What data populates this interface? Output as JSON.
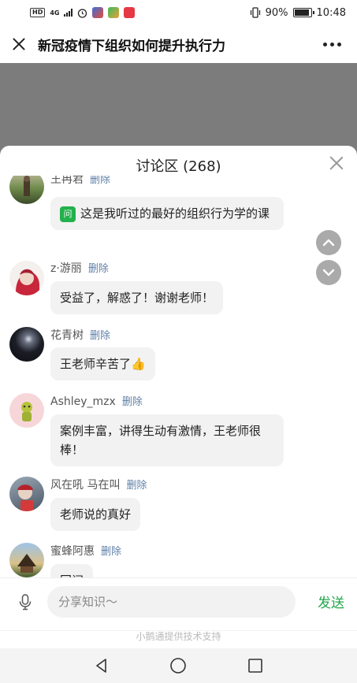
{
  "status": {
    "left": {
      "hd": "HD",
      "network": "4G"
    },
    "battery_text": "90%",
    "time": "10:48"
  },
  "header": {
    "title": "新冠疫情下组织如何提升执行力"
  },
  "panel": {
    "title": "讨论区 (268)",
    "delete_label": "删除",
    "comments": [
      {
        "name": "王冉君",
        "text": "这是我听过的最好的组织行为学的课",
        "tag": "问"
      },
      {
        "name": "z·游丽",
        "text": "受益了，解惑了！谢谢老师！"
      },
      {
        "name": "花青树",
        "text": "王老师辛苦了👍"
      },
      {
        "name": "Ashley_mzx",
        "text": "案例丰富，讲得生动有激情，王老师很棒！"
      },
      {
        "name": "风在吼 马在叫",
        "text": "老师说的真好"
      },
      {
        "name": "蜜蜂阿惠",
        "text": "同问"
      }
    ]
  },
  "input": {
    "placeholder": "分享知识～",
    "send_label": "发送"
  },
  "footer": {
    "powered_by": "小鹅通提供技术支持"
  },
  "icons": {
    "close": "close-icon",
    "more": "more-icon",
    "mic": "microphone-icon",
    "scroll_up": "chevron-up-icon",
    "scroll_down": "chevron-down-icon",
    "nav_back": "back-triangle-icon",
    "nav_home": "home-circle-icon",
    "nav_recent": "recent-square-icon"
  },
  "colors": {
    "accent_green": "#22a64a",
    "delete_link": "#5f7fa8",
    "overlay": "#7c7c7c"
  }
}
